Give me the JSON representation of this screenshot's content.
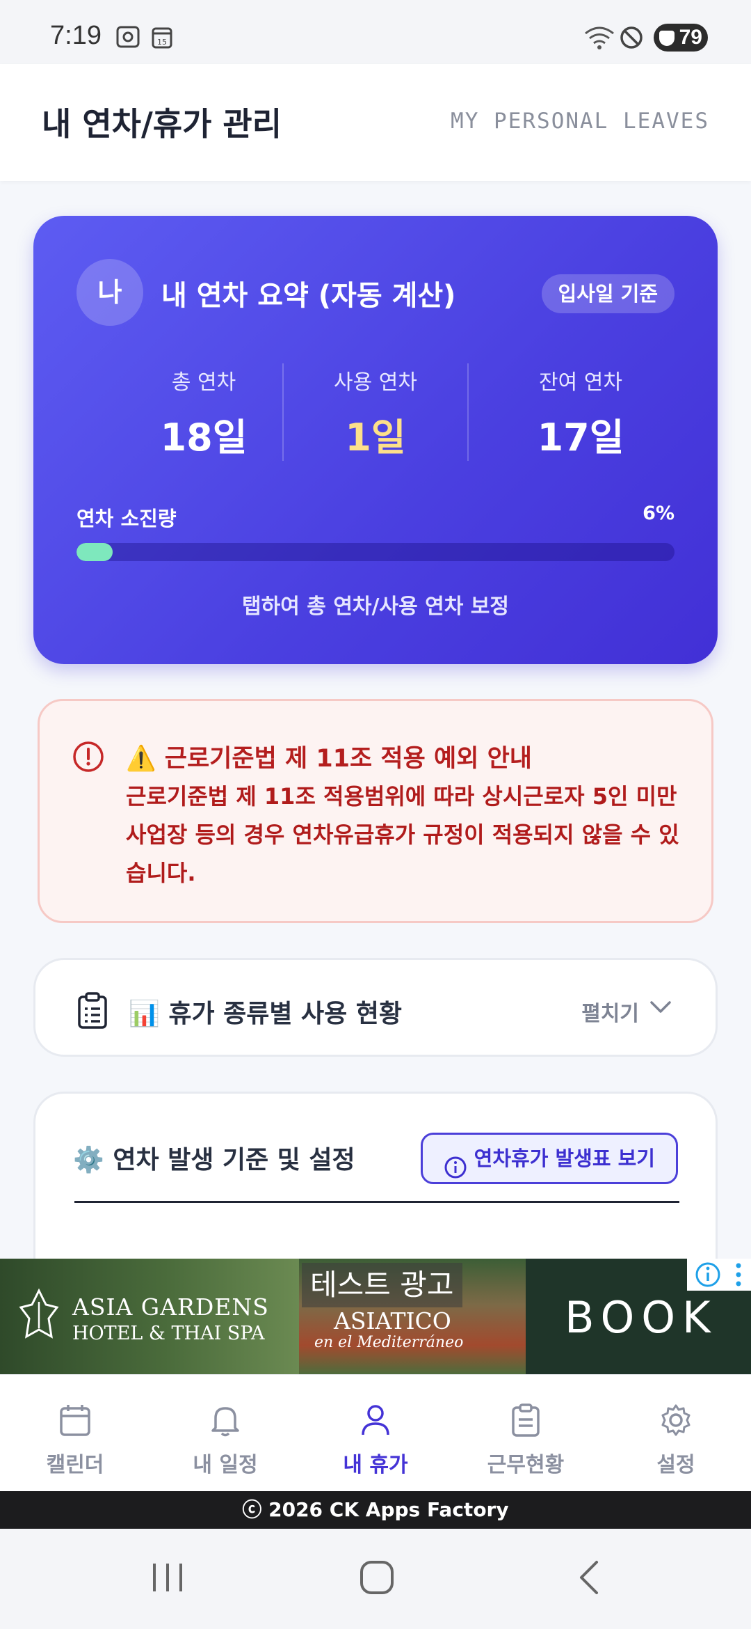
{
  "status_bar": {
    "time": "7:19",
    "battery": "79",
    "icons": [
      "screenshot-icon",
      "calendar-icon",
      "wifi-icon",
      "dnd-icon",
      "battery-icon"
    ]
  },
  "header": {
    "title": "내 연차/휴가 관리",
    "subtitle": "MY PERSONAL LEAVES"
  },
  "summary": {
    "avatar": "나",
    "title": "내 연차 요약 (자동 계산)",
    "badge": "입사일 기준",
    "stats": [
      {
        "label": "총 연차",
        "value": "18일"
      },
      {
        "label": "사용 연차",
        "value": "1일"
      },
      {
        "label": "잔여 연차",
        "value": "17일"
      }
    ],
    "usage_label": "연차 소진량",
    "usage_percent_text": "6%",
    "usage_fraction": 0.06,
    "tap_hint": "탭하여 총 연차/사용 연차 보정",
    "colors": {
      "accent": "#4a3fe0",
      "used": "#fde08a",
      "progress": "#7ee8bd"
    }
  },
  "alert": {
    "title": "⚠️ 근로기준법 제 11조 적용 예외 안내",
    "body": "근로기준법 제 11조 적용범위에 따라 상시근로자 5인 미만 사업장 등의 경우 연차유급휴가 규정이 적용되지 않을 수 있습니다.",
    "color": "#b41e1e"
  },
  "leave_types": {
    "title": "📊 휴가 종류별 사용 현황",
    "expand_label": "펼치기"
  },
  "settings": {
    "title": "⚙️ 연차 발생 기준 및 설정",
    "button_label": "연차휴가 발생표 보기"
  },
  "ad": {
    "test_label": "테스트 광고",
    "brand_line1": "ASIA GARDENS",
    "brand_line2": "HOTEL & THAI SPA",
    "mid_line1": "ASIATICO",
    "mid_line2": "en el Mediterráneo",
    "cta": "BOOK"
  },
  "nav": {
    "items": [
      {
        "label": "캘린더",
        "icon": "calendar-icon"
      },
      {
        "label": "내 일정",
        "icon": "bell-icon"
      },
      {
        "label": "내 휴가",
        "icon": "person-icon",
        "active": true
      },
      {
        "label": "근무현황",
        "icon": "clipboard-icon"
      },
      {
        "label": "설정",
        "icon": "gear-icon"
      }
    ]
  },
  "footer": {
    "text": "ⓒ 2026 CK Apps Factory"
  }
}
